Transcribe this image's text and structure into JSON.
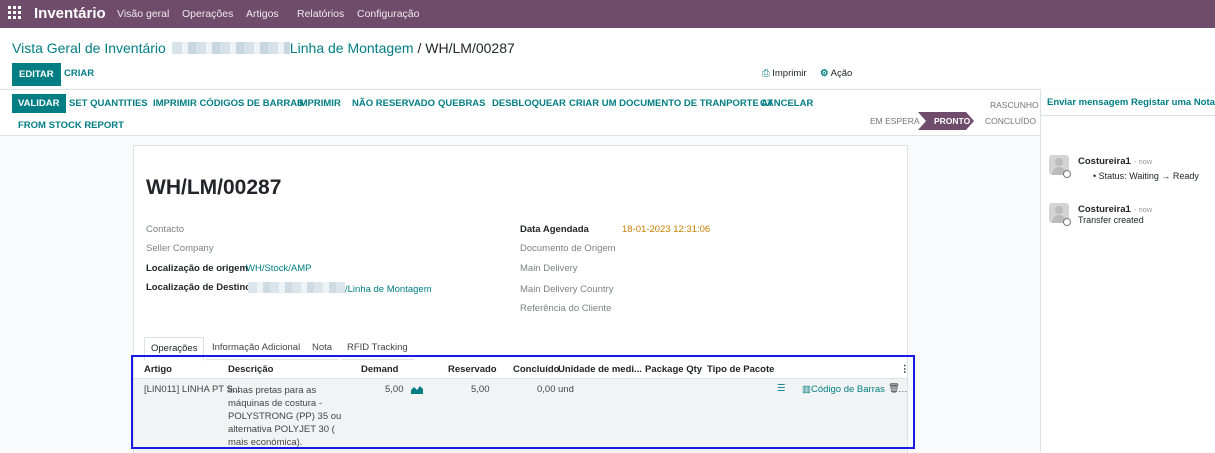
{
  "topbar": {
    "app_name": "Inventário",
    "menu": [
      "Visão geral",
      "Operações",
      "Artigos",
      "Relatórios",
      "Configuração"
    ]
  },
  "breadcrumb": {
    "root": "Vista Geral de Inventário",
    "sep": " / ",
    "current_prefix": "Linha de Montagem",
    "current": "WH/LM/00287"
  },
  "control": {
    "edit_label": "EDITAR",
    "create_label": "CRIAR",
    "print_label": "Imprimir",
    "action_label": "Ação"
  },
  "statusbar": {
    "buttons": [
      "VALIDAR",
      "SET QUANTITIES",
      "IMPRIMIR CÓDIGOS DE BARRAS",
      "IMPRIMIR",
      "NÃO RESERVADO",
      "QUEBRAS",
      "DESBLOQUEAR",
      "CRIAR UM DOCUMENTO DE TRANPORTE AT",
      "CANCELAR",
      "FROM STOCK REPORT"
    ],
    "stages": [
      "RASCUNHO",
      "EM ESPERA",
      "PRONTO",
      "CONCLUÍDO"
    ],
    "active_stage": "PRONTO",
    "accent_color": "#6f4c6b"
  },
  "chatter": {
    "send_message": "Enviar mensagem",
    "log_note": "Registar uma Nota",
    "messages": [
      {
        "author": "Costureira1",
        "when": "- now",
        "body": "Status: Waiting → Ready"
      },
      {
        "author": "Costureira1",
        "when": "- now",
        "body": "Transfer created"
      }
    ]
  },
  "form": {
    "title": "WH/LM/00287",
    "left_fields": [
      {
        "label": "Contacto",
        "value": ""
      },
      {
        "label": "Seller Company",
        "value": ""
      },
      {
        "label": "Localização de origem",
        "value": "WH/Stock/AMP"
      },
      {
        "label": "Localização de Destino",
        "value": "/Linha de Montagem"
      }
    ],
    "right_fields": [
      {
        "label": "Data Agendada",
        "value": "18-01-2023 12:31:06"
      },
      {
        "label": "Documento de Origem",
        "value": ""
      },
      {
        "label": "Main Delivery",
        "value": ""
      },
      {
        "label": "Main Delivery Country",
        "value": ""
      },
      {
        "label": "Referência do Cliente",
        "value": ""
      }
    ],
    "tabs": [
      "Operações",
      "Informação Adicional",
      "Nota",
      "RFID Tracking"
    ],
    "active_tab": "Operações"
  },
  "table": {
    "headers": [
      "Artigo",
      "Descrição",
      "Demand",
      "Reservado",
      "Concluído",
      "Unidade de medi...",
      "Package Qty",
      "Tipo de Pacote"
    ],
    "rows": [
      {
        "artigo": "[LIN011] LINHA PT S...",
        "descricao": [
          "linhas pretas para as",
          "máquinas de costura -",
          "POLYSTRONG (PP) 35 ou",
          "alternativa POLYJET 30 (",
          "mais económica)."
        ],
        "demand": "5,00",
        "reservado": "5,00",
        "concluido": "0,00",
        "unidade": "und",
        "barcode_label": "Código de Barras"
      }
    ]
  }
}
